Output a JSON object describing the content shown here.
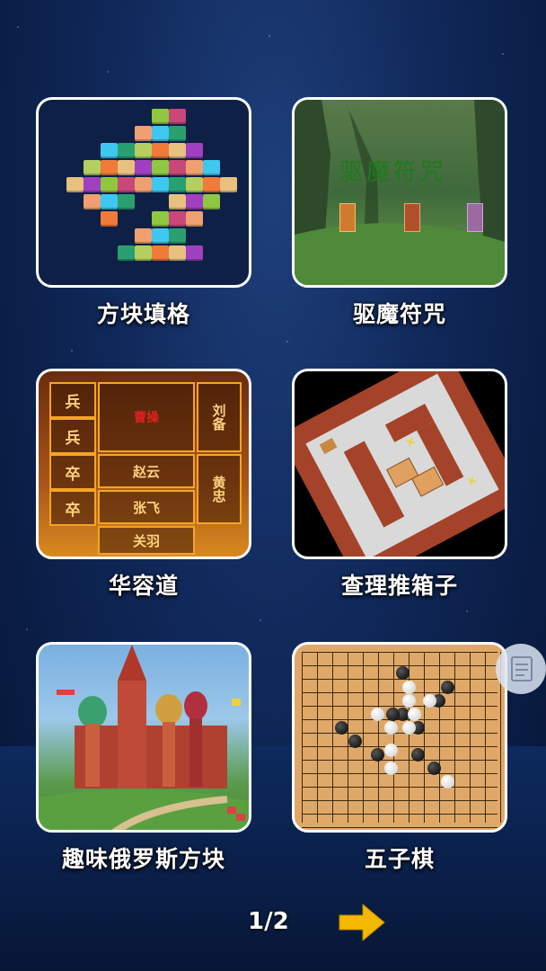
{
  "games": [
    {
      "title": "方块填格"
    },
    {
      "title": "驱魔符咒",
      "banner": "驱魔符咒"
    },
    {
      "title": "华容道",
      "pieces": [
        "兵",
        "兵",
        "卒",
        "卒",
        "曹操",
        "刘备",
        "赵云",
        "黄忠",
        "张飞",
        "关羽"
      ]
    },
    {
      "title": "查理推箱子"
    },
    {
      "title": "趣味俄罗斯方块"
    },
    {
      "title": "五子棋"
    }
  ],
  "pagination": {
    "label": "1/2"
  },
  "icons": {
    "next": "arrow-right-icon",
    "side": "document-icon"
  },
  "colors": {
    "accent_arrow": "#f5b800",
    "card_border": "#ffffff"
  }
}
